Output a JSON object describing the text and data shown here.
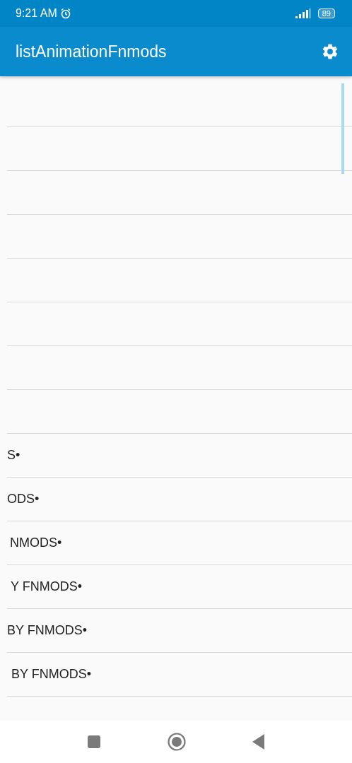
{
  "status_bar": {
    "time": "9:21 AM",
    "battery": "89"
  },
  "app_bar": {
    "title": "listAnimationFnmods"
  },
  "list": {
    "rows": [
      {
        "kind": "blank"
      },
      {
        "kind": "blank"
      },
      {
        "kind": "blank"
      },
      {
        "kind": "blank"
      },
      {
        "kind": "blank"
      },
      {
        "kind": "blank"
      },
      {
        "kind": "blank"
      },
      {
        "kind": "blank"
      },
      {
        "kind": "text",
        "text": "S•"
      },
      {
        "kind": "text",
        "text": "ODS•"
      },
      {
        "kind": "text",
        "text": "NMODS•"
      },
      {
        "kind": "text",
        "text": "Y FNMODS•"
      },
      {
        "kind": "text",
        "text": "BY FNMODS•"
      },
      {
        "kind": "text",
        "text": "BY FNMODS•"
      },
      {
        "kind": "blank"
      }
    ]
  }
}
